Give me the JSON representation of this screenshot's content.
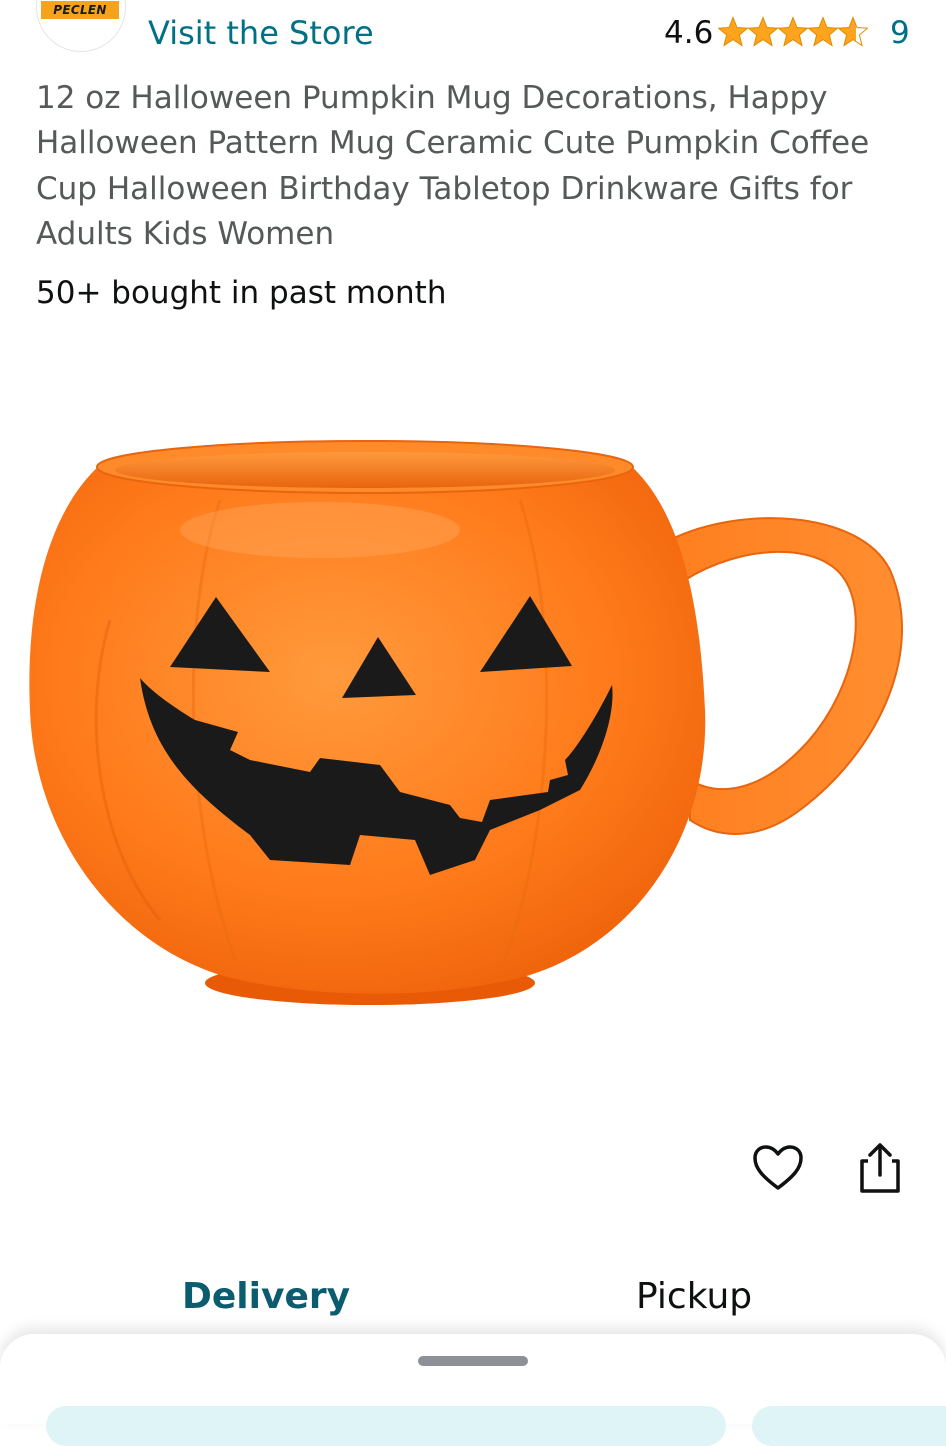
{
  "header": {
    "brand_logo_text": "PECLEN",
    "store_link_label": "Visit the Store",
    "rating_value": "4.6",
    "rating_stars": 4.6,
    "review_count": "9",
    "star_color": "#FFA41C",
    "link_color": "#007185"
  },
  "product": {
    "title": "12 oz Halloween Pumpkin Mug Decorations, Happy Halloween Pattern Mug Ceramic Cute Pumpkin Coffee Cup Halloween Birthday Tabletop Drinkware Gifts for Adults Kids Women",
    "bought_badge": "50+ bought in past month",
    "image_icon": "pumpkin-mug-image"
  },
  "actions": {
    "wishlist_icon": "heart-icon",
    "share_icon": "share-icon"
  },
  "tabs": [
    {
      "label": "Delivery",
      "active": true
    },
    {
      "label": "Pickup",
      "active": false
    }
  ],
  "colors": {
    "pumpkin_orange": "#FF7A1A",
    "active_tab": "#0B5C6E",
    "title_text": "#565959"
  }
}
